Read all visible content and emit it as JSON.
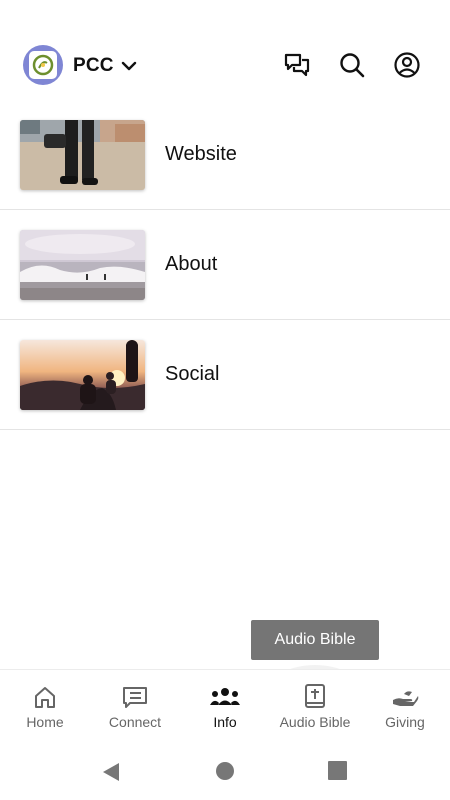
{
  "header": {
    "org_name": "PCC",
    "logo_icon": "pcc-logo-icon",
    "chevron_icon": "chevron-down-icon",
    "actions": [
      "chat-icon",
      "search-icon",
      "account-icon"
    ]
  },
  "list": {
    "items": [
      {
        "label": "Website",
        "thumbnail": "beach-feet-photo"
      },
      {
        "label": "About",
        "thumbnail": "ocean-waves-photo"
      },
      {
        "label": "Social",
        "thumbnail": "sunset-people-photo"
      }
    ]
  },
  "tooltip": {
    "text": "Audio Bible"
  },
  "bottom_nav": {
    "items": [
      {
        "label": "Home",
        "icon": "home-icon"
      },
      {
        "label": "Connect",
        "icon": "connect-icon"
      },
      {
        "label": "Info",
        "icon": "group-icon"
      },
      {
        "label": "Audio Bible",
        "icon": "bible-icon"
      },
      {
        "label": "Giving",
        "icon": "giving-hand-icon"
      }
    ],
    "active": "Info",
    "pressed": "Audio Bible"
  },
  "system_nav": [
    "back-icon",
    "home-circle-icon",
    "recents-icon"
  ],
  "colors": {
    "logo_bg": "#7f86d4",
    "logo_mark": "#6d8f2e",
    "tooltip_bg": "#757575",
    "active_text": "#111111",
    "inactive_text": "#666666"
  }
}
